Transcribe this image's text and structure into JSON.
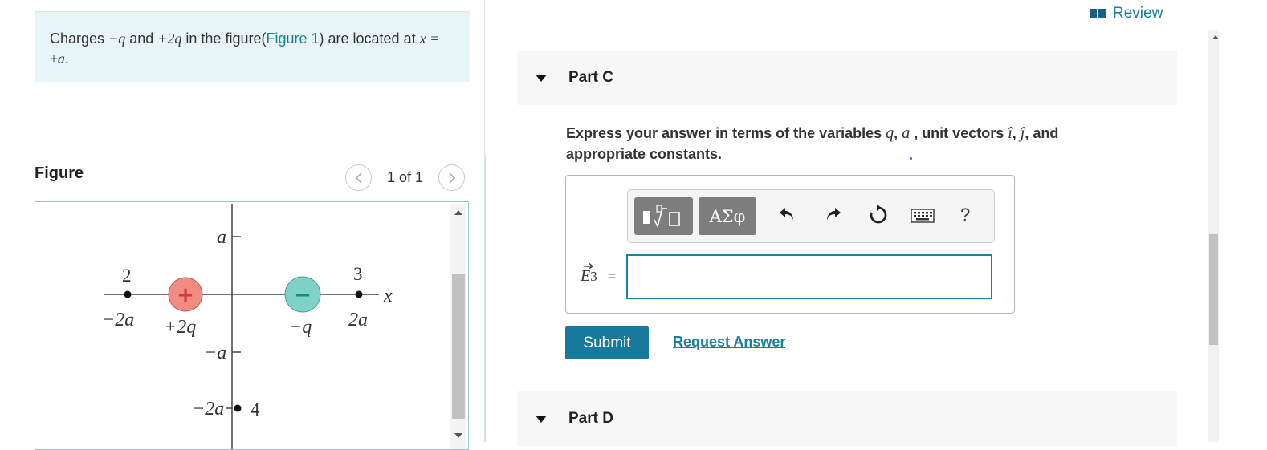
{
  "problem": {
    "text_before": "Charges ",
    "charge1": "−q",
    "text_and": " and ",
    "charge2": "+2q",
    "text_in_figure": " in the figure(",
    "figure_link": "Figure 1",
    "text_located": ") are located at ",
    "position": "x = ±a",
    "text_end": "."
  },
  "figure": {
    "heading": "Figure",
    "counter": "1 of 1",
    "labels": {
      "y_a": "a",
      "y_neg_a": "−a",
      "y_neg_2a": "−2a",
      "x_axis": "x",
      "x_neg_2a": "−2a",
      "x_2a": "2a",
      "charge_pos": "+2q",
      "charge_neg": "−q",
      "point_2": "2",
      "point_3": "3",
      "point_4": "4",
      "plus_sign": "+",
      "minus_sign": "−"
    }
  },
  "review": {
    "label": "Review"
  },
  "part_c": {
    "title": "Part C",
    "instruction_bold_1": "Express your answer in terms of the variables ",
    "var_q": "q",
    "sep1": ", ",
    "var_a": "a",
    "instruction_bold_2": " , unit vectors ",
    "unit_i": "î",
    "sep2": ", ",
    "unit_j": "ĵ",
    "instruction_bold_3": ", and appropriate constants.",
    "answer_label": "E",
    "answer_subscript": "3",
    "equals": "=",
    "answer_value": "",
    "toolbar": {
      "symbols_label": "ΑΣφ",
      "help_label": "?"
    },
    "submit_label": "Submit",
    "request_answer_label": "Request Answer"
  },
  "part_d": {
    "title": "Part D"
  },
  "colors": {
    "accent": "#1a7fa0",
    "submit_bg": "#177a9c",
    "problem_bg": "#e8f5f6",
    "positive_charge": "#f28b82",
    "negative_charge": "#7fd3c6"
  }
}
